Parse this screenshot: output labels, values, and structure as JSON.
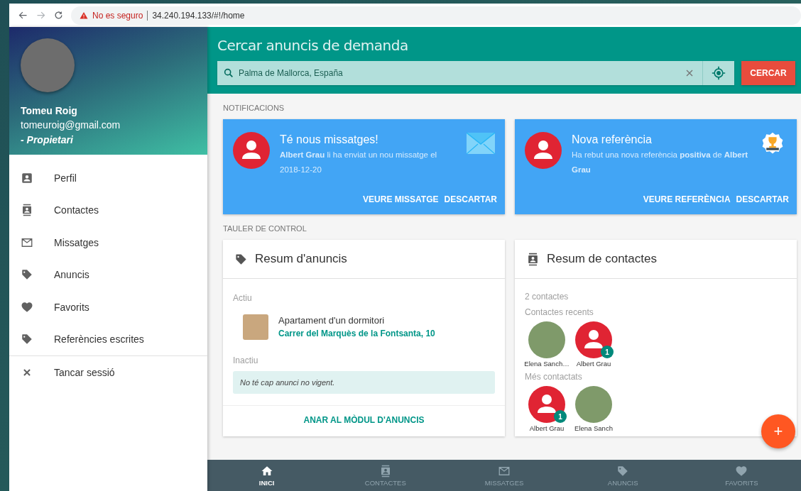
{
  "browser": {
    "security": "No es seguro",
    "url": "34.240.194.133/#!/home"
  },
  "sidebar": {
    "user": {
      "name": "Tomeu Roig",
      "email": "tomeuroig@gmail.com",
      "role": "- Propietari"
    },
    "items": [
      {
        "kind": "profile",
        "label": "Perfil"
      },
      {
        "kind": "contacts",
        "label": "Contactes"
      },
      {
        "kind": "mail",
        "label": "Missatges"
      },
      {
        "kind": "tag",
        "label": "Anuncis"
      },
      {
        "kind": "heart",
        "label": "Favorits"
      },
      {
        "kind": "tag",
        "label": "Referències escrites"
      }
    ],
    "logout": {
      "label": "Tancar sessió"
    }
  },
  "search": {
    "title": "Cercar anuncis de demanda",
    "value": "Palma de Mallorca, España",
    "button": "CERCAR"
  },
  "notifications": {
    "label": "NOTIFICACIONS",
    "cards": [
      {
        "kind": "message",
        "title": "Té nous missatges!",
        "body": "**Albert Grau** li ha enviat un nou missatge el 2018-12-20",
        "actions": [
          "VEURE MISSATGE",
          "DESCARTAR"
        ]
      },
      {
        "kind": "reference",
        "title": "Nova referència",
        "body": "Ha rebut una nova referència **positiva** de **Albert Grau**",
        "actions": [
          "VEURE REFERÈNCIA",
          "DESCARTAR"
        ]
      }
    ]
  },
  "dashboard": {
    "label": "TAULER DE CONTROL",
    "ads": {
      "title": "Resum d'anuncis",
      "active_label": "Actiu",
      "listing": {
        "title": "Apartament d'un dormitori",
        "address": "Carrer del Marquès de la Fontsanta, 10"
      },
      "inactive_label": "Inactiu",
      "empty": "No té cap anunci no vigent.",
      "link": "ANAR AL MÒDUL D'ANUNCIS"
    },
    "contacts": {
      "title": "Resum de contactes",
      "count": "2 contactes",
      "recent_label": "Contactes recents",
      "recent": [
        {
          "name": "Elena Sanch…",
          "kind": "photo"
        },
        {
          "name": "Albert Grau",
          "kind": "default",
          "badge": "1"
        }
      ],
      "most_label": "Més contactats",
      "most": [
        {
          "name": "Albert Grau",
          "kind": "default",
          "badge": "1"
        },
        {
          "name": "Elena Sanch",
          "kind": "photo"
        }
      ]
    }
  },
  "fab": "+",
  "bottom_nav": [
    {
      "kind": "home",
      "label": "INICI",
      "selected": true
    },
    {
      "kind": "contacts",
      "label": "CONTACTES",
      "selected": false
    },
    {
      "kind": "mail",
      "label": "MISSATGES",
      "selected": false
    },
    {
      "kind": "tag",
      "label": "ANUNCIS",
      "selected": false
    },
    {
      "kind": "heart",
      "label": "FAVORITS",
      "selected": false
    }
  ]
}
